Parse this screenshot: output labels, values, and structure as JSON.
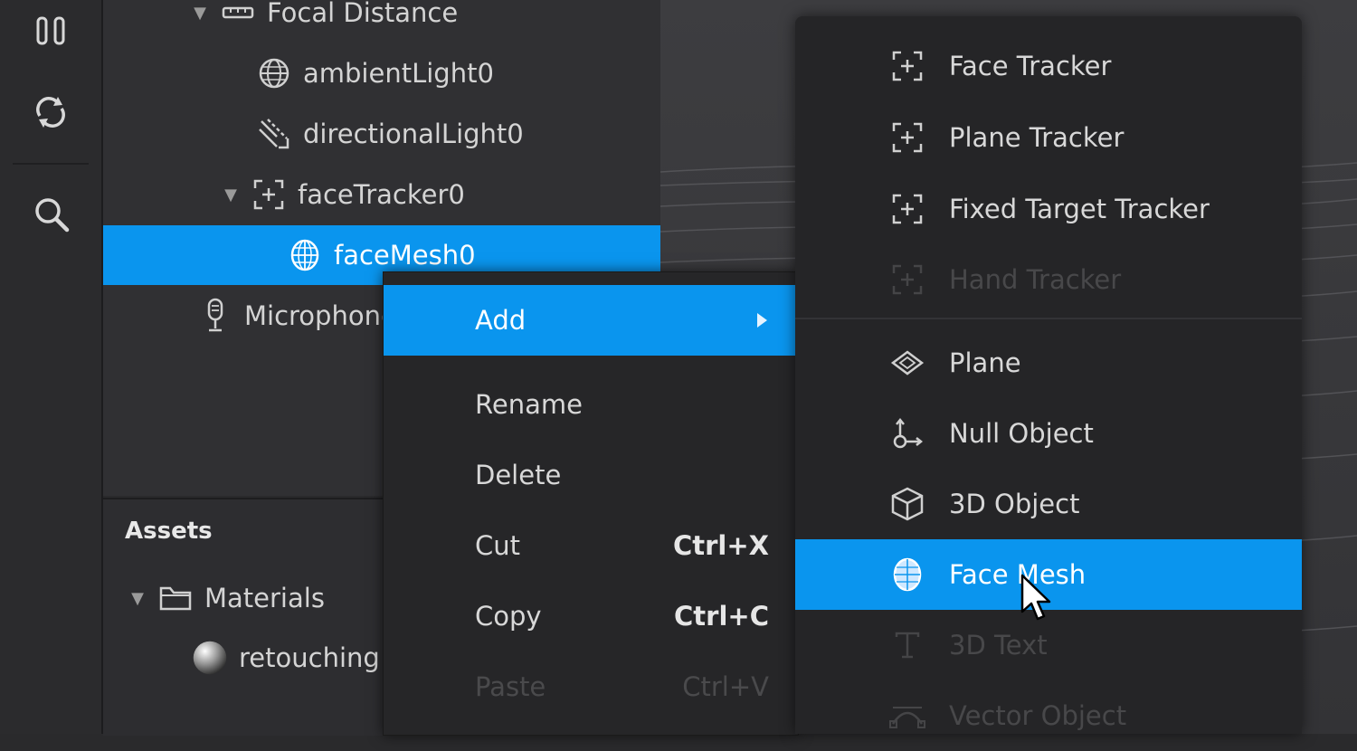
{
  "toolbar": {
    "icons": [
      "pause-icon",
      "refresh-icon",
      "search-icon"
    ]
  },
  "scene": {
    "rows": [
      {
        "label": "Focal Distance",
        "icon": "ruler-icon"
      },
      {
        "label": "ambientLight0",
        "icon": "globe-icon"
      },
      {
        "label": "directionalLight0",
        "icon": "directional-light-icon"
      },
      {
        "label": "faceTracker0",
        "icon": "face-tracker-icon"
      },
      {
        "label": "faceMesh0",
        "icon": "face-mesh-icon"
      },
      {
        "label": "Microphone",
        "icon": "microphone-icon"
      }
    ]
  },
  "assets": {
    "title": "Assets",
    "items": [
      {
        "label": "Materials",
        "icon": "folder-icon"
      },
      {
        "label": "retouching",
        "icon": "material-sphere-icon"
      }
    ]
  },
  "context_menu": {
    "items": [
      {
        "label": "Add",
        "shortcut": ""
      },
      {
        "label": "Rename",
        "shortcut": ""
      },
      {
        "label": "Delete",
        "shortcut": ""
      },
      {
        "label": "Cut",
        "shortcut": "Ctrl+X"
      },
      {
        "label": "Copy",
        "shortcut": "Ctrl+C"
      },
      {
        "label": "Paste",
        "shortcut": "Ctrl+V"
      }
    ]
  },
  "submenu": {
    "items": [
      {
        "label": "Face Tracker",
        "icon": "face-tracker-icon"
      },
      {
        "label": "Plane Tracker",
        "icon": "plane-tracker-icon"
      },
      {
        "label": "Fixed Target Tracker",
        "icon": "target-tracker-icon"
      },
      {
        "label": "Hand Tracker",
        "icon": "hand-tracker-icon"
      },
      {
        "label": "Plane",
        "icon": "plane-icon"
      },
      {
        "label": "Null Object",
        "icon": "null-object-icon"
      },
      {
        "label": "3D Object",
        "icon": "cube-icon"
      },
      {
        "label": "Face Mesh",
        "icon": "face-mesh-icon"
      },
      {
        "label": "3D Text",
        "icon": "text-icon"
      },
      {
        "label": "Vector Object",
        "icon": "vector-object-icon"
      }
    ]
  },
  "colors": {
    "accent": "#0a95ee",
    "panel": "#303033",
    "menu": "#262628"
  }
}
